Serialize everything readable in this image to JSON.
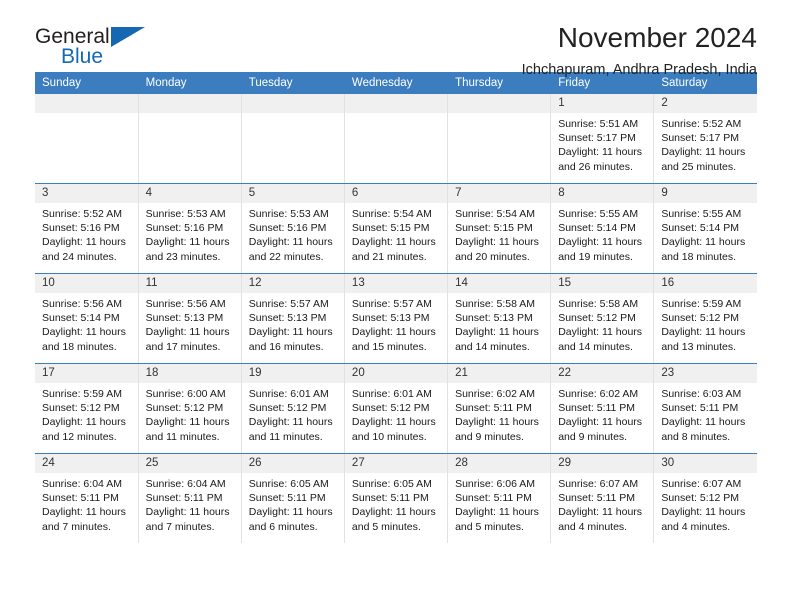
{
  "brand": {
    "name_top": "General",
    "name_bottom": "Blue",
    "accent_color": "#1668b3"
  },
  "header": {
    "title": "November 2024",
    "subtitle": "Ichchapuram, Andhra Pradesh, India"
  },
  "calendar": {
    "header_bg": "#3b7dbf",
    "daynum_bg": "#f0f0f0",
    "weekday_headers": [
      "Sunday",
      "Monday",
      "Tuesday",
      "Wednesday",
      "Thursday",
      "Friday",
      "Saturday"
    ],
    "labels": {
      "sunrise": "Sunrise:",
      "sunset": "Sunset:",
      "daylight": "Daylight:"
    },
    "weeks": [
      [
        {
          "day": ""
        },
        {
          "day": ""
        },
        {
          "day": ""
        },
        {
          "day": ""
        },
        {
          "day": ""
        },
        {
          "day": "1",
          "sunrise": "Sunrise: 5:51 AM",
          "sunset": "Sunset: 5:17 PM",
          "daylight": "Daylight: 11 hours and 26 minutes."
        },
        {
          "day": "2",
          "sunrise": "Sunrise: 5:52 AM",
          "sunset": "Sunset: 5:17 PM",
          "daylight": "Daylight: 11 hours and 25 minutes."
        }
      ],
      [
        {
          "day": "3",
          "sunrise": "Sunrise: 5:52 AM",
          "sunset": "Sunset: 5:16 PM",
          "daylight": "Daylight: 11 hours and 24 minutes."
        },
        {
          "day": "4",
          "sunrise": "Sunrise: 5:53 AM",
          "sunset": "Sunset: 5:16 PM",
          "daylight": "Daylight: 11 hours and 23 minutes."
        },
        {
          "day": "5",
          "sunrise": "Sunrise: 5:53 AM",
          "sunset": "Sunset: 5:16 PM",
          "daylight": "Daylight: 11 hours and 22 minutes."
        },
        {
          "day": "6",
          "sunrise": "Sunrise: 5:54 AM",
          "sunset": "Sunset: 5:15 PM",
          "daylight": "Daylight: 11 hours and 21 minutes."
        },
        {
          "day": "7",
          "sunrise": "Sunrise: 5:54 AM",
          "sunset": "Sunset: 5:15 PM",
          "daylight": "Daylight: 11 hours and 20 minutes."
        },
        {
          "day": "8",
          "sunrise": "Sunrise: 5:55 AM",
          "sunset": "Sunset: 5:14 PM",
          "daylight": "Daylight: 11 hours and 19 minutes."
        },
        {
          "day": "9",
          "sunrise": "Sunrise: 5:55 AM",
          "sunset": "Sunset: 5:14 PM",
          "daylight": "Daylight: 11 hours and 18 minutes."
        }
      ],
      [
        {
          "day": "10",
          "sunrise": "Sunrise: 5:56 AM",
          "sunset": "Sunset: 5:14 PM",
          "daylight": "Daylight: 11 hours and 18 minutes."
        },
        {
          "day": "11",
          "sunrise": "Sunrise: 5:56 AM",
          "sunset": "Sunset: 5:13 PM",
          "daylight": "Daylight: 11 hours and 17 minutes."
        },
        {
          "day": "12",
          "sunrise": "Sunrise: 5:57 AM",
          "sunset": "Sunset: 5:13 PM",
          "daylight": "Daylight: 11 hours and 16 minutes."
        },
        {
          "day": "13",
          "sunrise": "Sunrise: 5:57 AM",
          "sunset": "Sunset: 5:13 PM",
          "daylight": "Daylight: 11 hours and 15 minutes."
        },
        {
          "day": "14",
          "sunrise": "Sunrise: 5:58 AM",
          "sunset": "Sunset: 5:13 PM",
          "daylight": "Daylight: 11 hours and 14 minutes."
        },
        {
          "day": "15",
          "sunrise": "Sunrise: 5:58 AM",
          "sunset": "Sunset: 5:12 PM",
          "daylight": "Daylight: 11 hours and 14 minutes."
        },
        {
          "day": "16",
          "sunrise": "Sunrise: 5:59 AM",
          "sunset": "Sunset: 5:12 PM",
          "daylight": "Daylight: 11 hours and 13 minutes."
        }
      ],
      [
        {
          "day": "17",
          "sunrise": "Sunrise: 5:59 AM",
          "sunset": "Sunset: 5:12 PM",
          "daylight": "Daylight: 11 hours and 12 minutes."
        },
        {
          "day": "18",
          "sunrise": "Sunrise: 6:00 AM",
          "sunset": "Sunset: 5:12 PM",
          "daylight": "Daylight: 11 hours and 11 minutes."
        },
        {
          "day": "19",
          "sunrise": "Sunrise: 6:01 AM",
          "sunset": "Sunset: 5:12 PM",
          "daylight": "Daylight: 11 hours and 11 minutes."
        },
        {
          "day": "20",
          "sunrise": "Sunrise: 6:01 AM",
          "sunset": "Sunset: 5:12 PM",
          "daylight": "Daylight: 11 hours and 10 minutes."
        },
        {
          "day": "21",
          "sunrise": "Sunrise: 6:02 AM",
          "sunset": "Sunset: 5:11 PM",
          "daylight": "Daylight: 11 hours and 9 minutes."
        },
        {
          "day": "22",
          "sunrise": "Sunrise: 6:02 AM",
          "sunset": "Sunset: 5:11 PM",
          "daylight": "Daylight: 11 hours and 9 minutes."
        },
        {
          "day": "23",
          "sunrise": "Sunrise: 6:03 AM",
          "sunset": "Sunset: 5:11 PM",
          "daylight": "Daylight: 11 hours and 8 minutes."
        }
      ],
      [
        {
          "day": "24",
          "sunrise": "Sunrise: 6:04 AM",
          "sunset": "Sunset: 5:11 PM",
          "daylight": "Daylight: 11 hours and 7 minutes."
        },
        {
          "day": "25",
          "sunrise": "Sunrise: 6:04 AM",
          "sunset": "Sunset: 5:11 PM",
          "daylight": "Daylight: 11 hours and 7 minutes."
        },
        {
          "day": "26",
          "sunrise": "Sunrise: 6:05 AM",
          "sunset": "Sunset: 5:11 PM",
          "daylight": "Daylight: 11 hours and 6 minutes."
        },
        {
          "day": "27",
          "sunrise": "Sunrise: 6:05 AM",
          "sunset": "Sunset: 5:11 PM",
          "daylight": "Daylight: 11 hours and 5 minutes."
        },
        {
          "day": "28",
          "sunrise": "Sunrise: 6:06 AM",
          "sunset": "Sunset: 5:11 PM",
          "daylight": "Daylight: 11 hours and 5 minutes."
        },
        {
          "day": "29",
          "sunrise": "Sunrise: 6:07 AM",
          "sunset": "Sunset: 5:11 PM",
          "daylight": "Daylight: 11 hours and 4 minutes."
        },
        {
          "day": "30",
          "sunrise": "Sunrise: 6:07 AM",
          "sunset": "Sunset: 5:12 PM",
          "daylight": "Daylight: 11 hours and 4 minutes."
        }
      ]
    ]
  }
}
